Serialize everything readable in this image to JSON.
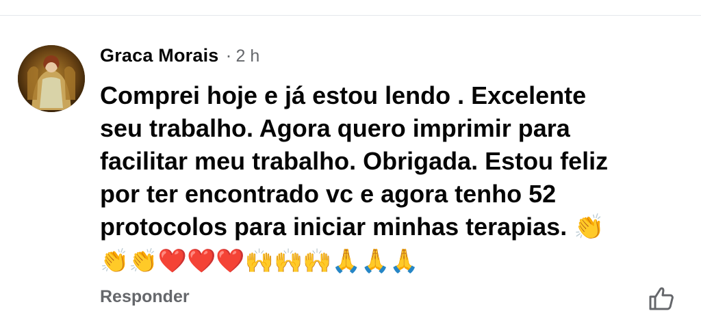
{
  "comment": {
    "author": "Graca Morais",
    "separator": "·",
    "time": "2 h",
    "text": "Comprei hoje e já estou lendo . Excelente\nseu trabalho. Agora quero imprimir para\nfacilitar meu trabalho. Obrigada. Estou feliz\npor ter encontrado vc e agora tenho 52\nprotocolos para iniciar minhas terapias. ",
    "trailing_emoji": "👏",
    "emoji_line": "👏👏❤️❤️❤️🙌🙌🙌🙏🙏🙏",
    "avatar_icon": "profile-photo"
  },
  "actions": {
    "reply_label": "Responder",
    "like_icon": "thumbs-up-outline-icon"
  },
  "colors": {
    "text": "#050505",
    "secondary_text": "#65676b",
    "divider": "#e4e6eb",
    "background": "#ffffff"
  }
}
